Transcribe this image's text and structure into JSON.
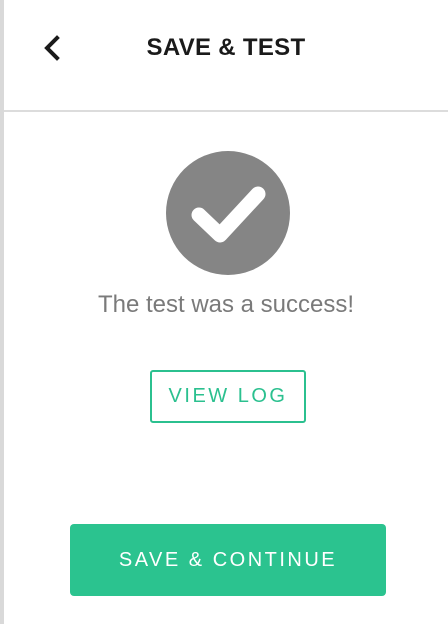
{
  "header": {
    "title": "SAVE & TEST",
    "back_icon": "chevron-left-icon"
  },
  "result": {
    "icon": "checkmark-circle-icon",
    "icon_color": "#858585",
    "message": "The test was a success!"
  },
  "actions": {
    "view_log_label": "VIEW LOG",
    "save_continue_label": "SAVE & CONTINUE",
    "accent_color": "#2bc38f"
  }
}
